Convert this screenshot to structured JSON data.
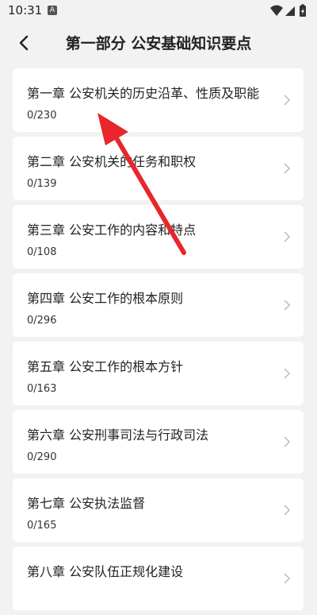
{
  "status": {
    "time": "10:31",
    "badge": "A"
  },
  "header": {
    "title": "第一部分 公安基础知识要点"
  },
  "colors": {
    "background": "#f2f2f2",
    "card": "#ffffff",
    "annotation_arrow": "#e8262b"
  },
  "chapters": [
    {
      "title": "第一章 公安机关的历史沿革、性质及职能",
      "count": "0/230"
    },
    {
      "title": "第二章 公安机关的任务和职权",
      "count": "0/139"
    },
    {
      "title": "第三章 公安工作的内容和特点",
      "count": "0/108"
    },
    {
      "title": "第四章 公安工作的根本原则",
      "count": "0/296"
    },
    {
      "title": "第五章 公安工作的根本方针",
      "count": "0/163"
    },
    {
      "title": "第六章 公安刑事司法与行政司法",
      "count": "0/290"
    },
    {
      "title": "第七章 公安执法监督",
      "count": "0/165"
    },
    {
      "title": "第八章 公安队伍正规化建设",
      "count": ""
    }
  ]
}
